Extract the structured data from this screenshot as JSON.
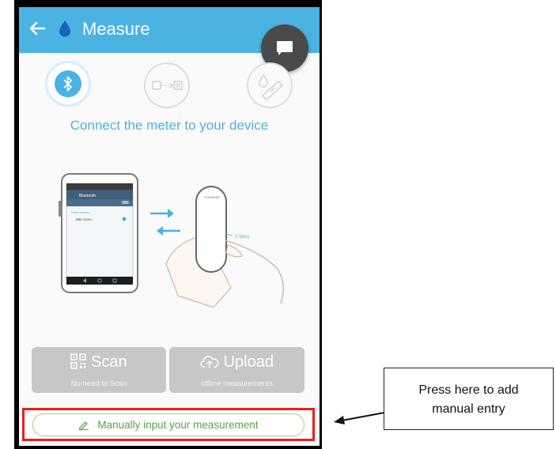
{
  "appbar": {
    "title": "Measure"
  },
  "headline": "Connect the meter to your device",
  "illustration": {
    "phone_header": "Bluetooth",
    "phone_device": "BBE 30001",
    "meter_label": "OneMeter",
    "hold_time": "3 Secs"
  },
  "buttons": {
    "scan": {
      "label": "Scan",
      "sublabel": "No need to Scan"
    },
    "upload": {
      "label": "Upload",
      "sublabel": "offline measurements"
    }
  },
  "manual": {
    "label": "Manually input your measurement"
  },
  "callout": {
    "line1": "Press here to add",
    "line2": "manual entry"
  },
  "colors": {
    "appbar": "#4ab3e2",
    "accent_green": "#58a545",
    "highlight": "#ee1c1c",
    "button_gray": "#c7c7c7"
  }
}
